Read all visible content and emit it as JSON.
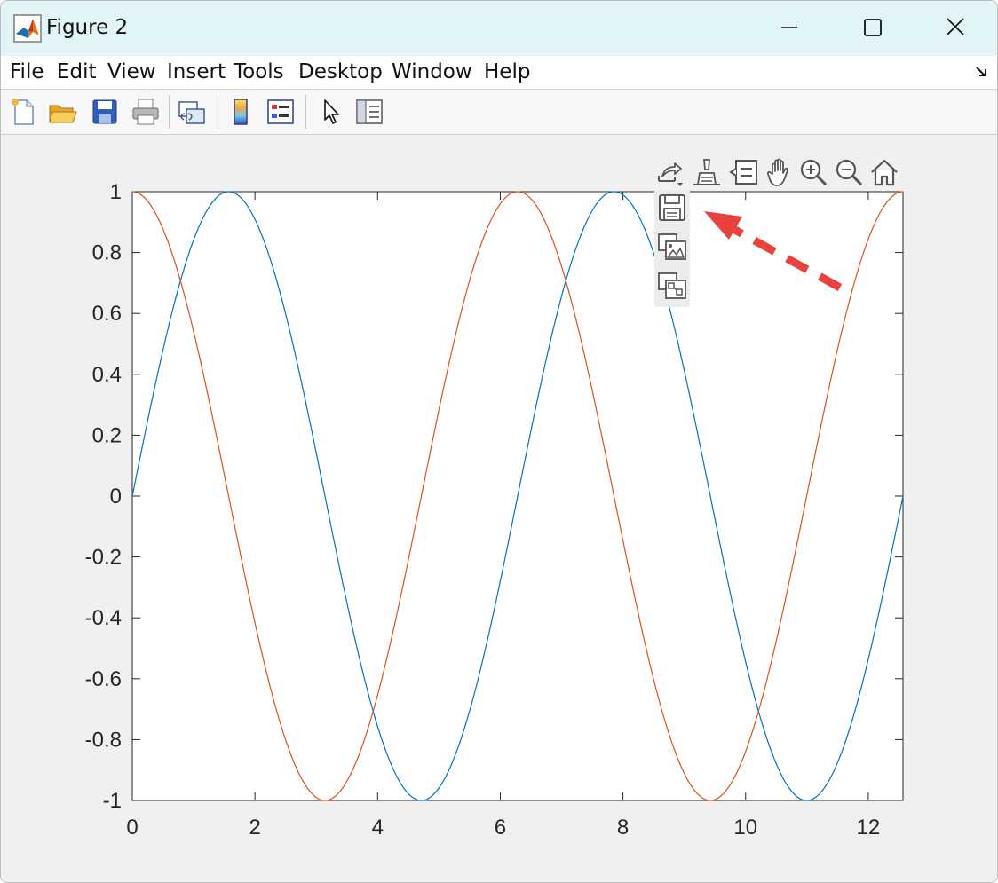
{
  "window": {
    "title": "Figure 2",
    "controls": {
      "minimize": "minimize-icon",
      "maximize": "maximize-icon",
      "close": "close-icon"
    }
  },
  "menu": {
    "items": [
      "File",
      "Edit",
      "View",
      "Insert",
      "Tools",
      "Desktop",
      "Window",
      "Help"
    ]
  },
  "toolbar": {
    "icons": [
      "new-figure-icon",
      "open-file-icon",
      "save-icon",
      "print-icon",
      "link-plot-icon",
      "colorbar-icon",
      "legend-icon",
      "edit-plot-arrow-icon",
      "property-inspector-icon"
    ]
  },
  "axes_toolbar": {
    "icons": [
      "export-icon",
      "brush-icon",
      "data-tips-icon",
      "pan-hand-icon",
      "zoom-in-icon",
      "zoom-out-icon",
      "restore-view-home-icon"
    ],
    "export_menu": [
      "save-as-icon",
      "copy-as-image-icon",
      "copy-as-vector-icon"
    ]
  },
  "annotation": {
    "arrow_color": "#e8413e",
    "arrow_style": "dashed"
  },
  "chart_data": {
    "type": "line",
    "title": "",
    "xlabel": "",
    "ylabel": "",
    "xlim": [
      0,
      12.566
    ],
    "ylim": [
      -1,
      1
    ],
    "xticks": [
      0,
      2,
      4,
      6,
      8,
      10,
      12
    ],
    "xtick_labels": [
      "0",
      "2",
      "4",
      "6",
      "8",
      "10",
      "12"
    ],
    "yticks": [
      1,
      0.8,
      0.6,
      0.4,
      0.2,
      0,
      -0.2,
      -0.4,
      -0.6,
      -0.8,
      -1
    ],
    "ytick_labels": [
      "1",
      "0.8",
      "0.6",
      "0.4",
      "0.2",
      "0",
      "-0.2",
      "-0.4",
      "-0.6",
      "-0.8",
      "-1"
    ],
    "grid": false,
    "legend": false,
    "series": [
      {
        "function": "sin",
        "color": "#0072bd",
        "x": [
          0,
          0.785,
          1.571,
          2.356,
          3.142,
          3.927,
          4.712,
          5.498,
          6.283,
          7.069,
          7.854,
          8.639,
          9.425,
          10.21,
          10.996,
          11.781,
          12.566
        ],
        "values": [
          0,
          0.707,
          1,
          0.707,
          0,
          -0.707,
          -1,
          -0.707,
          0,
          0.707,
          1,
          0.707,
          0,
          -0.707,
          -1,
          -0.707,
          0
        ]
      },
      {
        "function": "cos",
        "color": "#d95319",
        "x": [
          0,
          0.785,
          1.571,
          2.356,
          3.142,
          3.927,
          4.712,
          5.498,
          6.283,
          7.069,
          7.854,
          8.639,
          9.425,
          10.21,
          10.996,
          11.781,
          12.566
        ],
        "values": [
          1,
          0.707,
          0,
          -0.707,
          -1,
          -0.707,
          0,
          0.707,
          1,
          0.707,
          0,
          -0.707,
          -1,
          -0.707,
          0,
          0.707,
          1
        ]
      }
    ]
  }
}
